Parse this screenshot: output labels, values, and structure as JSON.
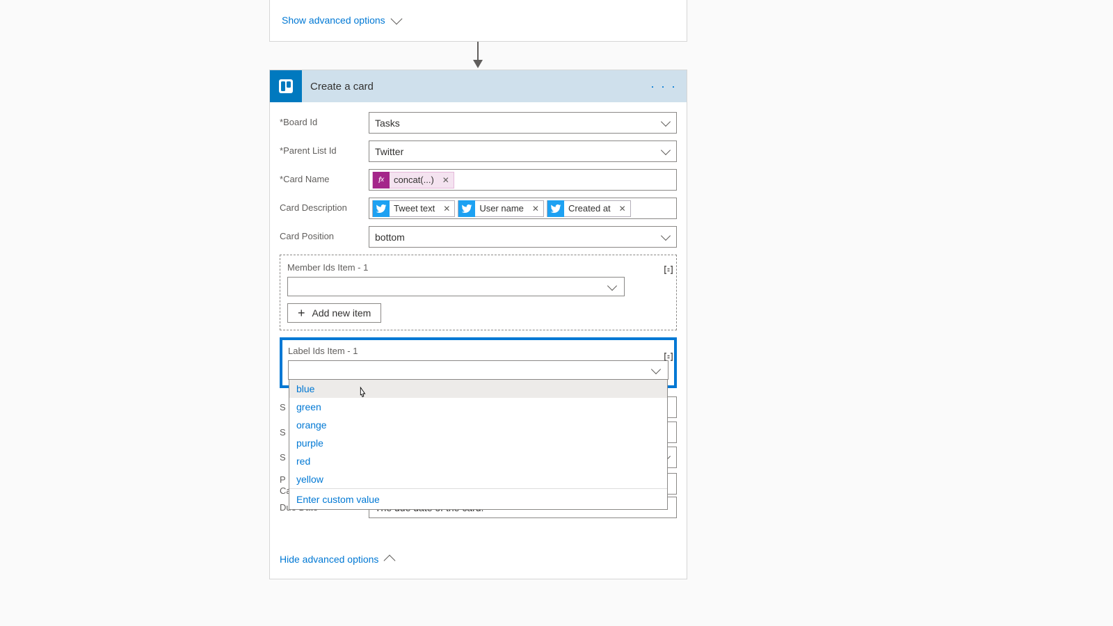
{
  "top": {
    "show_advanced": "Show advanced options"
  },
  "action": {
    "title": "Create a card",
    "ellipsis": "· · ·"
  },
  "fields": {
    "board_id": {
      "label": "Board Id",
      "value": "Tasks"
    },
    "parent_list_id": {
      "label": "Parent List Id",
      "value": "Twitter"
    },
    "card_name": {
      "label": "Card Name",
      "token_fx": "concat(...)"
    },
    "card_description": {
      "label": "Card Description",
      "tokens": [
        "Tweet text",
        "User name",
        "Created at"
      ]
    },
    "card_position": {
      "label": "Card Position",
      "value": "bottom"
    },
    "member_ids": {
      "label": "Member Ids Item - 1",
      "add_button": "Add new item"
    },
    "label_ids": {
      "label": "Label Ids Item - 1",
      "options": [
        "blue",
        "green",
        "orange",
        "purple",
        "red",
        "yellow"
      ],
      "custom": "Enter custom value"
    },
    "hidden_rows": {
      "s1": "S",
      "s2": "S",
      "s3": "S",
      "p_label_1": "P",
      "p_label_2": "Card",
      "due_date_label": "Due Date",
      "due_date_placeholder": "The due date of the card."
    }
  },
  "footer": {
    "hide_advanced": "Hide advanced options"
  }
}
